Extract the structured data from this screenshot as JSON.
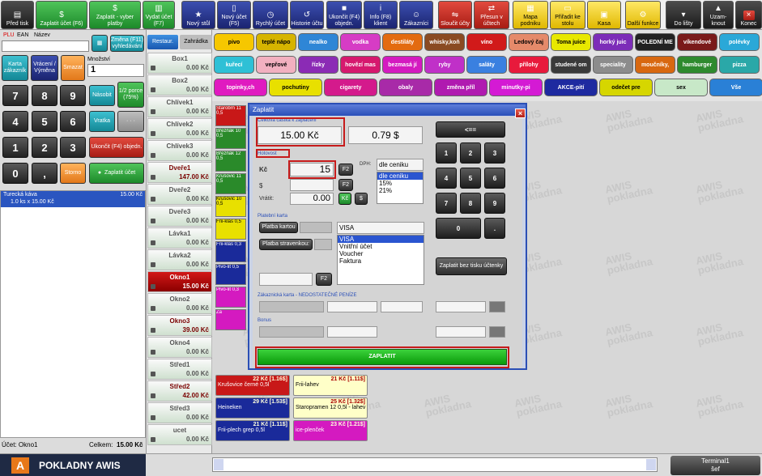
{
  "toolbar": {
    "buttons": [
      {
        "label": "Před tisk"
      },
      {
        "label": "Zaplatit účet (F6)"
      },
      {
        "label": "Zaplatit - vyber platby"
      },
      {
        "label": "Vydat účet (F7)"
      },
      {
        "label": "Nový stůl"
      },
      {
        "label": "Nový účet (F5)"
      },
      {
        "label": "Rychlý účet"
      },
      {
        "label": "Historie účtu"
      },
      {
        "label": "Ukončit (F4) objedn."
      },
      {
        "label": "Info (F8) klient"
      },
      {
        "label": "Zákazníci"
      },
      {
        "label": "Sloučit účty"
      },
      {
        "label": "Přesun v účtech"
      },
      {
        "label": "Mapa podniku"
      },
      {
        "label": "Přiřadit ke stolu"
      },
      {
        "label": "Kasa"
      },
      {
        "label": "Další funkce"
      },
      {
        "label": "Do lišty"
      },
      {
        "label": "Uzam-knout"
      },
      {
        "label": "Konec"
      }
    ]
  },
  "left": {
    "plu_tab": "PLU",
    "ean_tab": "EAN",
    "name_tab": "Název",
    "zmena_btn": "Změna (F11) vyhledávání",
    "karta_btn": "Karta zákazník",
    "vraceni_btn": "Vrácení / Výměna",
    "smazat_btn": "Smazat",
    "mnozstvi_label": "Množství",
    "mnozstvi_value": "1",
    "keys": [
      "7",
      "8",
      "9",
      "4",
      "5",
      "6",
      "1",
      "2",
      "3",
      "0",
      ","
    ],
    "nasobit_btn": "Násobit",
    "porce_btn": "1/2 porce (75%)",
    "vratka_btn": "Vratka",
    "ukoncit_btn": "Ukončit (F4) objedn.",
    "storno_btn": "Storno",
    "zaplatit_btn": "Zaplatit účet",
    "order_item_name": "Turecká káva",
    "order_item_price": "15.00 Kč",
    "order_item_detail": "1.0 ks x 15.00 Kč",
    "ucet_label": "Účet:",
    "ucet_value": "Okno1",
    "celkem_label": "Celkem:",
    "celkem_value": "15.00 Kč"
  },
  "tables": {
    "tabs": [
      "Restaur.",
      "Zahrádka"
    ],
    "items": [
      {
        "name": "Box1",
        "price": "0.00 Kč",
        "state": "free"
      },
      {
        "name": "Box2",
        "price": "0.00 Kč",
        "state": "free"
      },
      {
        "name": "Chlívek1",
        "price": "0.00 Kč",
        "state": "free"
      },
      {
        "name": "Chlívek2",
        "price": "0.00 Kč",
        "state": "free"
      },
      {
        "name": "Chlívek3",
        "price": "0.00 Kč",
        "state": "free"
      },
      {
        "name": "Dveře1",
        "price": "147.00 Kč",
        "state": "occ"
      },
      {
        "name": "Dveře2",
        "price": "0.00 Kč",
        "state": "free"
      },
      {
        "name": "Dveře3",
        "price": "0.00 Kč",
        "state": "free"
      },
      {
        "name": "Lávka1",
        "price": "0.00 Kč",
        "state": "free"
      },
      {
        "name": "Lávka2",
        "price": "0.00 Kč",
        "state": "free"
      },
      {
        "name": "Okno1",
        "price": "15.00 Kč",
        "state": "act"
      },
      {
        "name": "Okno2",
        "price": "0.00 Kč",
        "state": "free"
      },
      {
        "name": "Okno3",
        "price": "39.00 Kč",
        "state": "occ"
      },
      {
        "name": "Okno4",
        "price": "0.00 Kč",
        "state": "free"
      },
      {
        "name": "Střed1",
        "price": "0.00 Kč",
        "state": "free"
      },
      {
        "name": "Střed2",
        "price": "42.00 Kč",
        "state": "occ"
      },
      {
        "name": "Střed3",
        "price": "0.00 Kč",
        "state": "free"
      },
      {
        "name": "ucet",
        "price": "0.00 Kč",
        "state": "free"
      }
    ]
  },
  "categories": [
    {
      "label": "pivo",
      "color": "#f6c700"
    },
    {
      "label": "teplé nápo",
      "color": "#d6b400"
    },
    {
      "label": "nealko",
      "color": "#2f86d6"
    },
    {
      "label": "vodka",
      "color": "#d63cc5"
    },
    {
      "label": "destiláty",
      "color": "#e36b10"
    },
    {
      "label": "whisky,koň",
      "color": "#8a4a22"
    },
    {
      "label": "víno",
      "color": "#d11a1a"
    },
    {
      "label": "Ledový čaj",
      "color": "#e58a6a"
    },
    {
      "label": "Toma juice",
      "color": "#e8e800"
    },
    {
      "label": "horký juic",
      "color": "#7c2db8"
    },
    {
      "label": "POLEDNÍ ME",
      "color": "#222222"
    },
    {
      "label": "víkendové",
      "color": "#7a1a1a"
    },
    {
      "label": "polévky",
      "color": "#2aa8d8"
    },
    {
      "label": "kuřecí",
      "color": "#2ec0d6"
    },
    {
      "label": "vepřové",
      "color": "#f2b0c0"
    },
    {
      "label": "řízky",
      "color": "#8b2bb5"
    },
    {
      "label": "hovězí mas",
      "color": "#d6186e"
    },
    {
      "label": "bezmasá jí",
      "color": "#d41ac0"
    },
    {
      "label": "ryby",
      "color": "#c030c8"
    },
    {
      "label": "saláty",
      "color": "#3a80e0"
    },
    {
      "label": "přílohy",
      "color": "#e81a3c"
    },
    {
      "label": "studené om",
      "color": "#3a3a3a"
    },
    {
      "label": "speciality",
      "color": "#8c8c8c"
    },
    {
      "label": "moučníky,",
      "color": "#d86810"
    },
    {
      "label": "hamburger",
      "color": "#2e8a2e"
    },
    {
      "label": "pizza",
      "color": "#2aa8a8"
    },
    {
      "label": "topinky,ch",
      "color": "#e01ac0"
    },
    {
      "label": "pochutiny",
      "color": "#e8e000"
    },
    {
      "label": "cigarety",
      "color": "#d41a8c"
    },
    {
      "label": "obaly",
      "color": "#a82aa8"
    },
    {
      "label": "změna příl",
      "color": "#b01ab0"
    },
    {
      "label": "minutky-pi",
      "color": "#d41ad4"
    },
    {
      "label": "AKCE-pití",
      "color": "#1e2aa0"
    },
    {
      "label": "odečet pre",
      "color": "#d6d600"
    },
    {
      "label": "sex",
      "color": "#c8e8c8"
    },
    {
      "label": "Vše",
      "color": "#2a80d6"
    }
  ],
  "products": [
    {
      "name": "Krušovice černé 0,5l",
      "price": "22 Kč [1.16$]",
      "color": "#c81818"
    },
    {
      "name": "Frii-lahev",
      "price": "21 Kč [1.11$]",
      "color": "#ffffc8"
    },
    {
      "name": "Heineken",
      "price": "29 Kč [1.53$]",
      "color": "#1a2a9a"
    },
    {
      "name": "Staropramen 12 0,5l - lahev",
      "price": "25 Kč [1.32$]",
      "color": "#ffffc8"
    },
    {
      "name": "Frii-plech grep 0,5l",
      "price": "21 Kč [1.11$]",
      "color": "#1a2a9a"
    },
    {
      "name": "ice-plenček",
      "price": "23 Kč [1.21$]",
      "color": "#d41ac0"
    }
  ],
  "background_labels": [
    "Starobrn 11 0,5",
    "Březňák 10 0,5",
    "Březňák 12 0,5",
    "Krušovic 11 0,5",
    "Krušovic 10 0,5",
    "Frii-klas 0,5",
    "Frii-klas 0,3",
    "Pivo-lit 0,5",
    "Pivo-lit 0,3",
    "Za",
    "Sk",
    "Tip",
    "Za"
  ],
  "watermark": {
    "line1": "AWIS",
    "line2": "pokladna"
  },
  "dialog": {
    "title": "Zaplatit",
    "celkova_label": "Celková částka k zaplacení",
    "total_czk": "15.00 Kč",
    "total_usd": "0.79 $",
    "hotovost_label": "Hotovost",
    "kc_label": "Kč",
    "kc_value": "15",
    "usd_label": "$",
    "vratit_label": "Vrátit:",
    "vratit_value": "0.00",
    "f2": "F2",
    "kc_btn": "Kč",
    "usd_btn": "$",
    "dph_label": "DPH:",
    "dph_selected": "dle ceniku",
    "dph_options": [
      "dle ceniku",
      "15%",
      "21%"
    ],
    "platebni_label": "Platební karta",
    "platba_kartou_btn": "Platba kartou",
    "platba_strav_btn": "Platba stravenkou:",
    "card_selected": "VISA",
    "card_options": [
      "VISA",
      "Vnitřní účet",
      "Voucher",
      "Faktura"
    ],
    "zakaznicka_label": "Zákaznická karta - NEDOSTATEČNÉ PENÍZE",
    "bonus_label": "Bonus",
    "numpad": [
      "<==",
      "1",
      "2",
      "3",
      "4",
      "5",
      "6",
      "7",
      "8",
      "9",
      "0",
      "."
    ],
    "bez_tisku_btn": "Zaplatit bez tisku účtenky",
    "zaplatit_btn": "ZAPLATIT",
    "close_icon": "×"
  },
  "bottom": {
    "logo_text": "POKLADNY AWIS",
    "terminal_line1": "Terminal1",
    "terminal_line2": "šef"
  }
}
